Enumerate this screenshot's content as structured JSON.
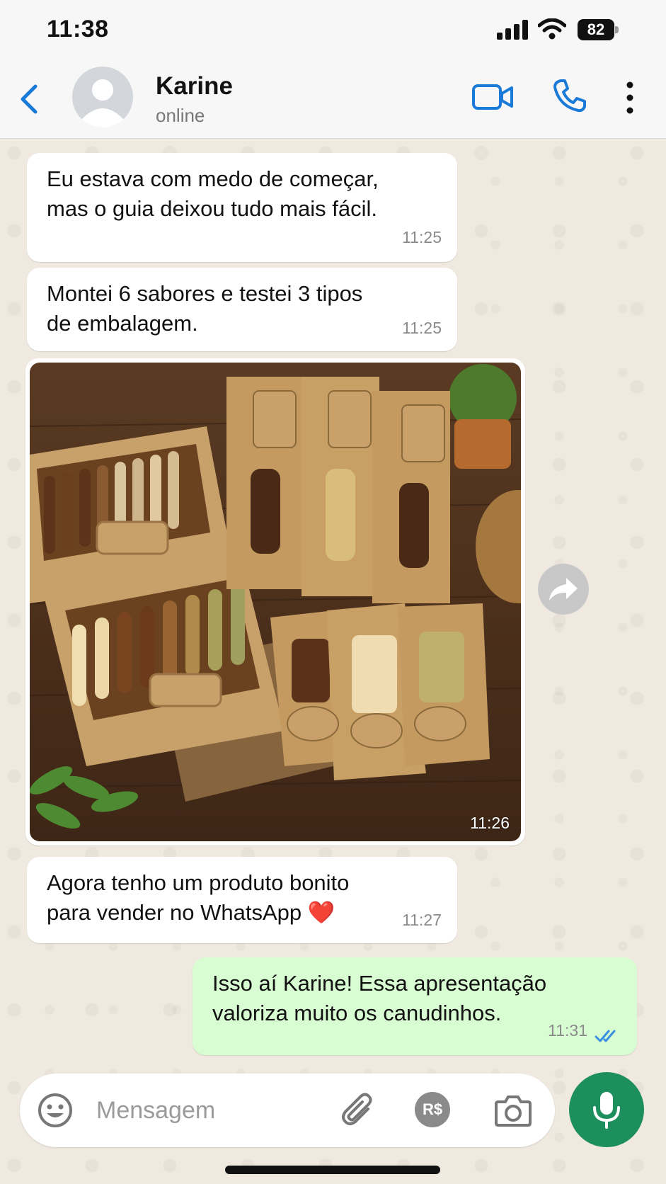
{
  "status_bar": {
    "time": "11:38",
    "battery": "82",
    "icons": [
      "signal-icon",
      "wifi-icon",
      "battery-icon"
    ]
  },
  "header": {
    "contact_name": "Karine",
    "contact_status": "online",
    "icons": [
      "back-chevron-icon",
      "avatar-icon",
      "video-call-icon",
      "phone-icon",
      "more-options-icon"
    ],
    "accent_color": "#1a7ad8"
  },
  "messages": [
    {
      "direction": "incoming",
      "text": "Eu estava com medo de começar,\nmas o guia deixou tudo mais fácil.",
      "time": "11:25"
    },
    {
      "direction": "incoming",
      "text": "Montei 6 sabores e testei 3 tipos\nde embalagem.",
      "time": "11:25"
    },
    {
      "direction": "incoming",
      "type": "image",
      "time": "11:26"
    },
    {
      "direction": "incoming",
      "text": "Agora tenho um produto bonito\npara vender no WhatsApp ❤️",
      "time": "11:27"
    },
    {
      "direction": "outgoing",
      "text": "Isso aí Karine! Essa apresentação\nvaloriza muito os canudinhos.",
      "time": "11:31",
      "status": "read"
    }
  ],
  "composer": {
    "placeholder": "Mensagem",
    "money_label": "R$",
    "icons": [
      "emoji-icon",
      "attach-clip-icon",
      "payment-icon",
      "camera-icon",
      "microphone-icon"
    ],
    "mic_color": "#1c8f5d"
  },
  "colors": {
    "incoming_bubble": "#ffffff",
    "outgoing_bubble": "#d9fdd3",
    "chat_background": "#efeae2",
    "read_ticks": "#3a8fe0"
  }
}
